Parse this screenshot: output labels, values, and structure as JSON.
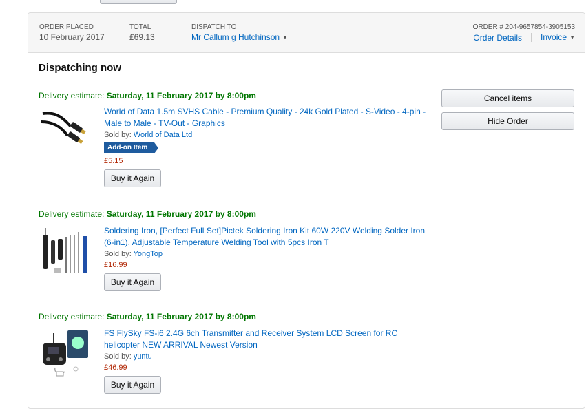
{
  "order": {
    "placed_label": "ORDER PLACED",
    "placed_value": "10 February 2017",
    "total_label": "TOTAL",
    "total_value": "£69.13",
    "dispatch_label": "DISPATCH TO",
    "dispatch_value": "Mr Callum g Hutchinson",
    "order_number": "ORDER # 204-9657854-3905153",
    "details_link": "Order Details",
    "invoice_link": "Invoice"
  },
  "section_title": "Dispatching now",
  "actions": {
    "cancel_label": "Cancel items",
    "hide_label": "Hide Order"
  },
  "items": [
    {
      "delivery_label": "Delivery estimate:",
      "delivery_date": "Saturday, 11 February 2017 by 8:00pm",
      "title": "World of Data 1.5m SVHS Cable - Premium Quality - 24k Gold Plated - S-Video - 4-pin - Male to Male - TV-Out - Graphics",
      "sold_by_label": "Sold by:",
      "seller": "World of Data Ltd",
      "badge": "Add-on Item",
      "price": "£5.15",
      "button": "Buy it Again"
    },
    {
      "delivery_label": "Delivery estimate:",
      "delivery_date": "Saturday, 11 February 2017 by 8:00pm",
      "title": "Soldering Iron, [Perfect Full Set]Pictek Soldering Iron Kit 60W 220V Welding Solder Iron (6-in1), Adjustable Temperature Welding Tool with 5pcs Iron T",
      "sold_by_label": "Sold by:",
      "seller": "YongTop",
      "price": "£16.99",
      "button": "Buy it Again"
    },
    {
      "delivery_label": "Delivery estimate:",
      "delivery_date": "Saturday, 11 February 2017 by 8:00pm",
      "title": "FS FlySky FS-i6 2.4G 6ch Transmitter and Receiver System LCD Screen for RC helicopter NEW ARRIVAL Newest Version",
      "sold_by_label": "Sold by:",
      "seller": "yuntu",
      "price": "£46.99",
      "button": "Buy it Again"
    }
  ],
  "colors": {
    "link": "#0066c0",
    "delivery_green": "#007600",
    "price_red": "#b12704",
    "badge_blue": "#1e5b9e"
  }
}
